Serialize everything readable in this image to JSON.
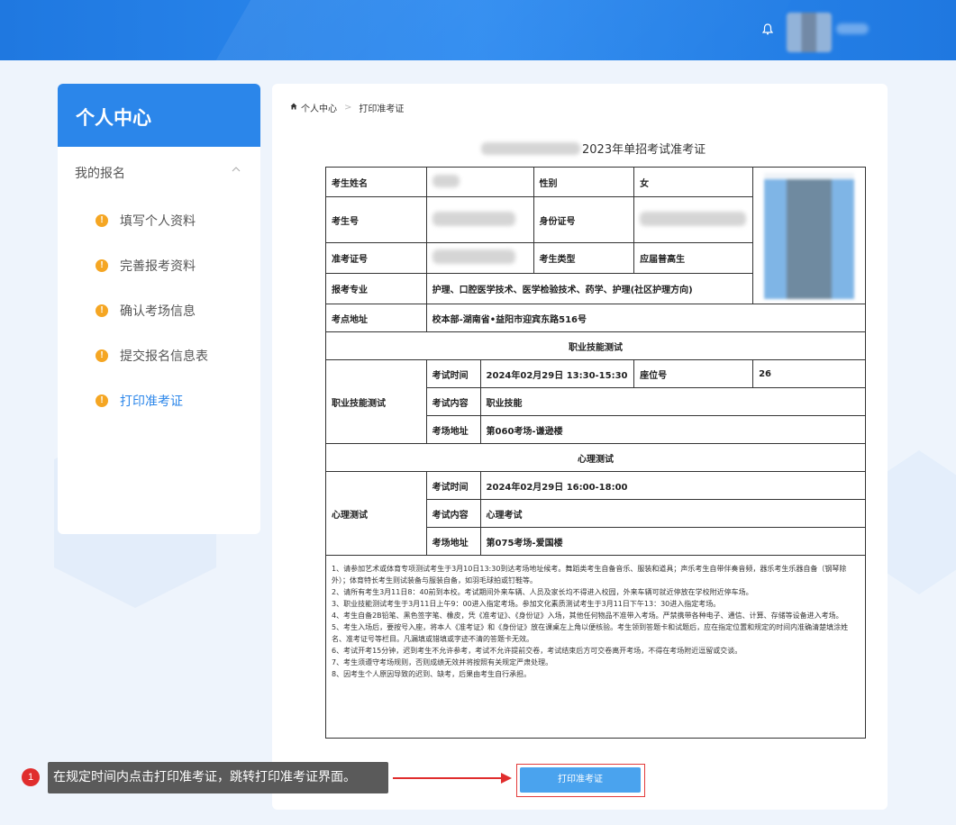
{
  "header": {
    "bell_icon": "bell-icon"
  },
  "sidebar": {
    "title": "个人中心",
    "group_title": "我的报名",
    "items": [
      {
        "label": "填写个人资料",
        "icon": "warning-icon"
      },
      {
        "label": "完善报考资料",
        "icon": "warning-icon"
      },
      {
        "label": "确认考场信息",
        "icon": "warning-icon"
      },
      {
        "label": "提交报名信息表",
        "icon": "warning-icon"
      },
      {
        "label": "打印准考证",
        "icon": "warning-icon",
        "active": true
      }
    ],
    "warn_glyph": "!"
  },
  "breadcrumb": {
    "home": "个人中心",
    "current": "打印准考证"
  },
  "ticket": {
    "title_suffix": "2023年单招考试准考证",
    "rows": {
      "name_label": "考生姓名",
      "gender_label": "性别",
      "gender_value": "女",
      "examinee_no_label": "考生号",
      "id_label": "身份证号",
      "admission_no_label": "准考证号",
      "type_label": "考生类型",
      "type_value": "应届普高生",
      "major_label": "报考专业",
      "major_value": "护理、口腔医学技术、医学检验技术、药学、护理(社区护理方向)",
      "site_label": "考点地址",
      "site_value": "校本部-湖南省•益阳市迎宾东路516号"
    },
    "vocational": {
      "section_title": "职业技能测试",
      "row_label": "职业技能测试",
      "time_label": "考试时间",
      "time_value": "2024年02月29日 13:30-15:30",
      "seat_label": "座位号",
      "seat_value": "26",
      "content_label": "考试内容",
      "content_value": "职业技能",
      "room_label": "考场地址",
      "room_value": "第060考场-谦逊楼"
    },
    "psych": {
      "section_title": "心理测试",
      "row_label": "心理测试",
      "time_label": "考试时间",
      "time_value": "2024年02月29日 16:00-18:00",
      "content_label": "考试内容",
      "content_value": "心理考试",
      "room_label": "考场地址",
      "room_value": "第075考场-爱国楼"
    },
    "notes": [
      "1、请参加艺术或体育专项测试考生于3月10日13:30到达考场地址候考。舞蹈类考生自备音乐、服装和道具；声乐考生自带伴奏音频，器乐考生乐器自备（钢琴除外）；体育特长考生则试装备与服装自备，如羽毛球拍或钉鞋等。",
      "2、请所有考生3月11日8：40前到本校。考试期间外来车辆、人员及家长均不得进入校园，外来车辆可就近停放在学校附近停车场。",
      "3、职业技能测试考生于3月11日上午9：00进入指定考场。参加文化素质测试考生于3月11日下午13：30进入指定考场。",
      "4、考生自备2B铅笔、黑色签字笔、橡皮，凭《准考证》、《身份证》入场，其他任何物品不准带入考场。严禁携带各种电子、通信、计算、存储等设备进入考场。",
      "5、考生入场后，要按号入座，将本人《准考证》和《身份证》放在课桌左上角以便核验。考生领到答题卡和试题后，应在指定位置和规定的时间内准确清楚填涂姓名、准考证号等栏目。凡漏填或错填或字迹不清的答题卡无效。",
      "6、考试开考15分钟，迟到考生不允许参考，考试不允许提前交卷，考试结束后方可交卷离开考场，不得在考场附近逗留或交谈。",
      "7、考生须遵守考场规则，否则成绩无效并将按照有关规定严肃处理。",
      "8、因考生个人原因导致的迟到、缺考，后果由考生自行承担。"
    ]
  },
  "print_button": "打印准考证",
  "annotation": {
    "step": "1",
    "tip": "在规定时间内点击打印准考证，跳转打印准考证界面。"
  }
}
